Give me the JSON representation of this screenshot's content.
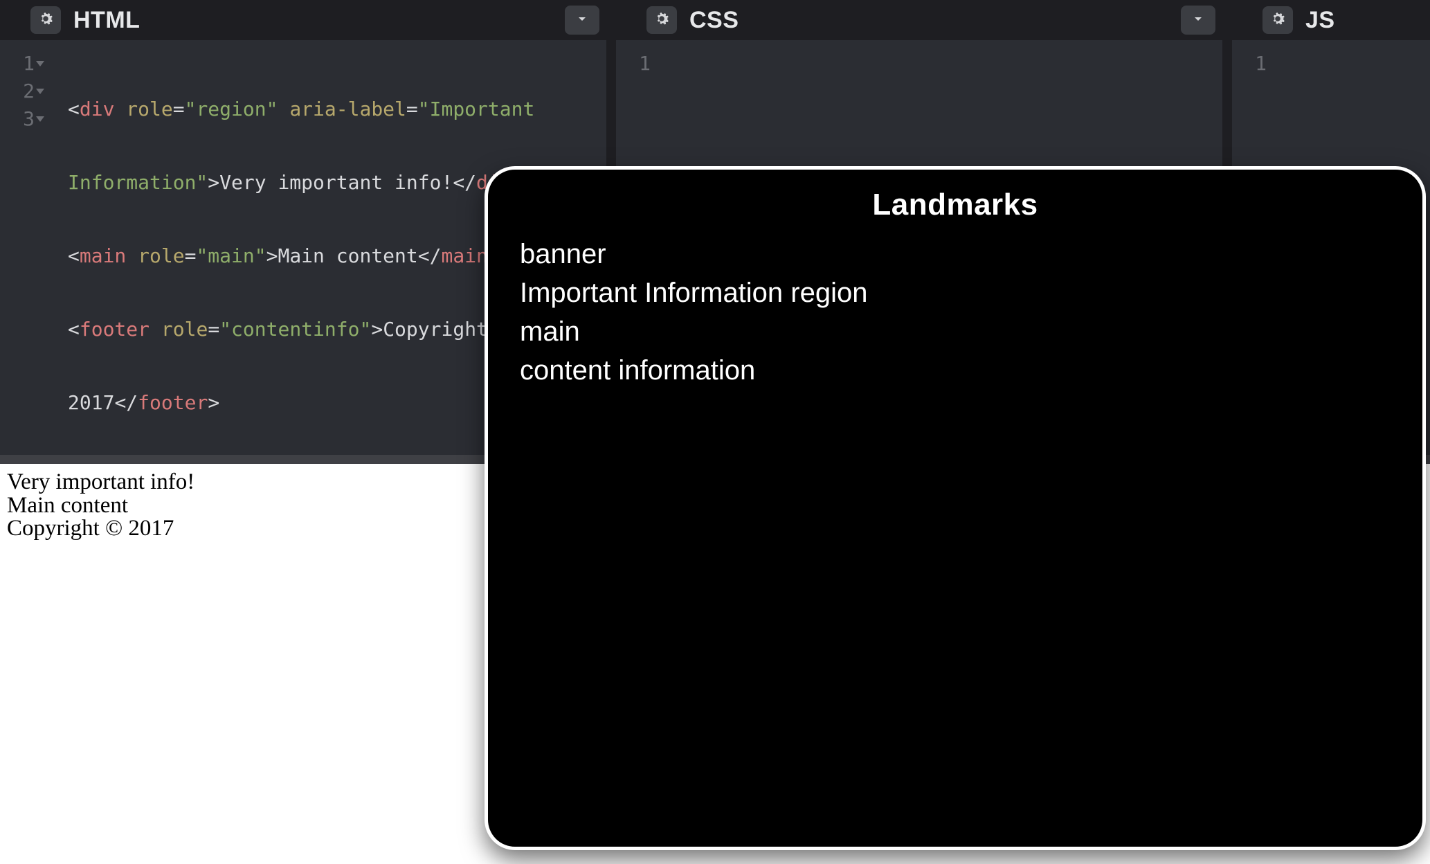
{
  "panels": {
    "html": {
      "title": "HTML"
    },
    "css": {
      "title": "CSS"
    },
    "js": {
      "title": "JS"
    }
  },
  "gutter": {
    "html": [
      "1",
      "",
      "2",
      "3",
      ""
    ],
    "css": [
      "1"
    ],
    "js": [
      "1"
    ]
  },
  "html_code": {
    "line1": {
      "open": "<",
      "tag": "div",
      "sp1": " ",
      "attr1": "role",
      "eq1": "=",
      "str1": "\"region\"",
      "sp2": " ",
      "attr2": "aria-label",
      "eq2": "=",
      "str2_a": "\"Important "
    },
    "line1b": {
      "str2_b": "Information\"",
      "gt": ">",
      "text": "Very important info!",
      "closeopen": "</",
      "tag": "div",
      "closegt": ">"
    },
    "line2": {
      "open": "<",
      "tag": "main",
      "sp1": " ",
      "attr1": "role",
      "eq1": "=",
      "str1": "\"main\"",
      "gt": ">",
      "text": "Main content",
      "closeopen": "</",
      "tagc": "main",
      "closegt": ">"
    },
    "line3": {
      "open": "<",
      "tag": "footer",
      "sp1": " ",
      "attr1": "role",
      "eq1": "=",
      "str1": "\"contentinfo\"",
      "gt": ">",
      "text": "Copyright &copy; "
    },
    "line3b": {
      "text": "2017",
      "closeopen": "</",
      "tag": "footer",
      "closegt": ">"
    }
  },
  "output": {
    "l1": "Very important info!",
    "l2": "Main content",
    "l3": "Copyright © 2017"
  },
  "rotor": {
    "title": "Landmarks",
    "items": [
      "banner",
      "Important Information region",
      "main",
      "content information"
    ]
  }
}
